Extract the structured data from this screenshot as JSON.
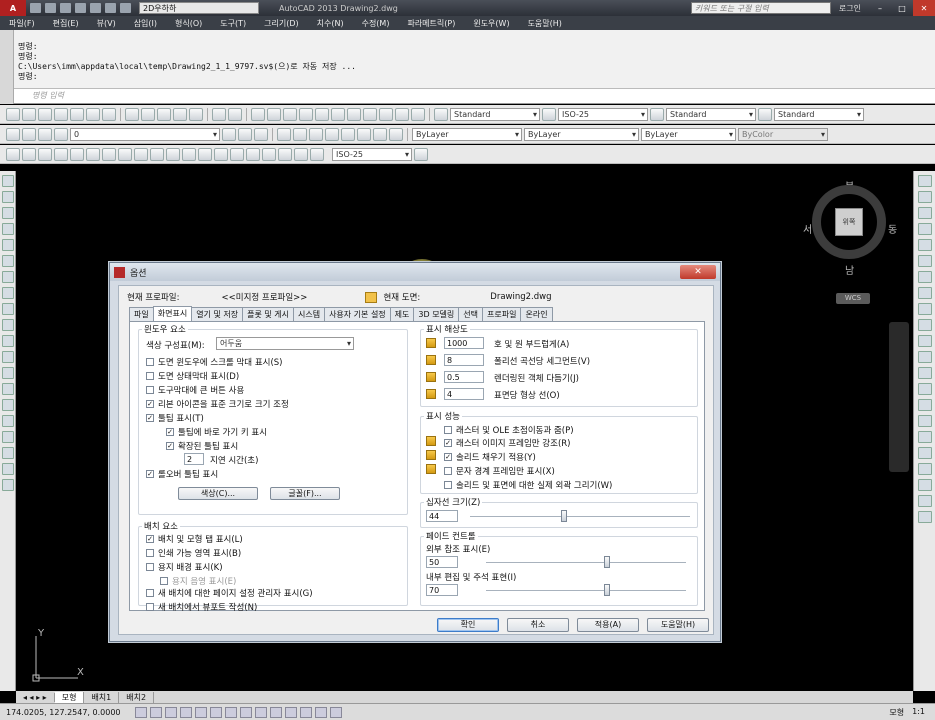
{
  "titlebar": {
    "workspace": "2D우하하",
    "app_title": "AutoCAD 2013   Drawing2.dwg",
    "search_placeholder": "키워드 또는 구절 입력",
    "login": "로그인",
    "min": "–",
    "max": "□",
    "close": "✕"
  },
  "menubar": {
    "items": [
      "파일(F)",
      "편집(E)",
      "뷰(V)",
      "삽입(I)",
      "형식(O)",
      "도구(T)",
      "그리기(D)",
      "치수(N)",
      "수정(M)",
      "파라메트릭(P)",
      "윈도우(W)",
      "도움말(H)"
    ]
  },
  "command": {
    "history": [
      "명령:",
      "명령:",
      "C:\\Users\\imm\\appdata\\local\\temp\\Drawing2_1_1_9797.sv$(으)로 자동 저장 ...",
      "명령:"
    ],
    "input_placeholder": "명령 입력"
  },
  "toolbars": {
    "text_style": "Standard",
    "dim_style": "ISO-25",
    "table_style": "Standard",
    "multileader_style": "Standard",
    "layer": "0",
    "color": "ByLayer",
    "linetype": "ByLayer",
    "lineweight": "ByLayer",
    "plotstyle": "ByColor",
    "dim_style2": "ISO-25"
  },
  "viewcube": {
    "north": "북",
    "south": "남",
    "east": "동",
    "west": "서",
    "face": "위쪽",
    "wcs": "WCS"
  },
  "ucs": {
    "x": "X",
    "y": "Y"
  },
  "layout_tabs": [
    "모형",
    "배치1",
    "배치2"
  ],
  "status": {
    "coords": "174.0205, 127.2547, 0.0000",
    "model": "모형",
    "scale": "1:1"
  },
  "dialog": {
    "title": "옵션",
    "close": "✕",
    "current_profile_label": "현재 프로파일:",
    "current_profile_value": "<<미지정 프로파일>>",
    "current_drawing_label": "현재 도면:",
    "current_drawing_value": "Drawing2.dwg",
    "tabs": [
      "파일",
      "화면표시",
      "열기 및 저장",
      "플롯 및 게시",
      "시스템",
      "사용자 기본 설정",
      "제도",
      "3D 모델링",
      "선택",
      "프로파일",
      "온라인"
    ],
    "window_elements": {
      "title": "윈도우 요소",
      "color_scheme_label": "색상 구성표(M):",
      "color_scheme_value": "어두움",
      "opts": [
        {
          "label": "도면 윈도우에 스크롤 막대 표시(S)",
          "checked": false
        },
        {
          "label": "도면 상태막대 표시(D)",
          "checked": false
        },
        {
          "label": "도구막대에 큰 버튼 사용",
          "checked": false
        },
        {
          "label": "리본 아이콘을 표준 크기로 크기 조정",
          "checked": true
        },
        {
          "label": "툴팁 표시(T)",
          "checked": true
        },
        {
          "label": "툴팁에 바로 가기 키 표시",
          "checked": true
        },
        {
          "label": "확장된 툴팁 표시",
          "checked": true
        },
        {
          "label": "롤오버 툴팁 표시",
          "checked": true
        }
      ],
      "delay_value": "2",
      "delay_label": "지연 시간(초)",
      "colors_btn": "색상(C)...",
      "fonts_btn": "글꼴(F)..."
    },
    "layout_elements": {
      "title": "배치 요소",
      "opts": [
        {
          "label": "배치 및 모형 탭 표시(L)",
          "checked": true
        },
        {
          "label": "인쇄 가능 영역 표시(B)",
          "checked": false
        },
        {
          "label": "용지 배경 표시(K)",
          "checked": false
        },
        {
          "label": "용지 음영 표시(E)",
          "checked": false
        },
        {
          "label": "새 배치에 대한 페이지 설정 관리자 표시(G)",
          "checked": false
        },
        {
          "label": "새 배치에서 뷰포트 작성(N)",
          "checked": false
        }
      ]
    },
    "resolution": {
      "title": "표시 해상도",
      "items": [
        {
          "value": "1000",
          "label": "호 및 원 부드럽게(A)"
        },
        {
          "value": "8",
          "label": "폴리선 곡선당 세그먼트(V)"
        },
        {
          "value": "0.5",
          "label": "렌더링된 객체 다듬기(J)"
        },
        {
          "value": "4",
          "label": "표면당 형상 선(O)"
        }
      ]
    },
    "performance": {
      "title": "표시 성능",
      "opts": [
        {
          "label": "래스터 및 OLE 초점이동과 줌(P)",
          "checked": false
        },
        {
          "label": "래스터 이미지 프레임만 강조(R)",
          "checked": true
        },
        {
          "label": "솔리드 채우기 적용(Y)",
          "checked": true
        },
        {
          "label": "문자 경계 프레임만 표시(X)",
          "checked": false
        },
        {
          "label": "솔리드 및 표면에 대한 실제 외곽 그리기(W)",
          "checked": false
        }
      ]
    },
    "crosshair": {
      "title": "십자선 크기(Z)",
      "value": "44"
    },
    "fade": {
      "title": "페이드 컨트롤",
      "xref_label": "외부 참조 표시(E)",
      "xref_value": "50",
      "inplace_label": "내부 편집 및 주석 표현(I)",
      "inplace_value": "70"
    },
    "buttons": {
      "ok": "확인",
      "cancel": "취소",
      "apply": "적용(A)",
      "help": "도움말(H)"
    }
  }
}
